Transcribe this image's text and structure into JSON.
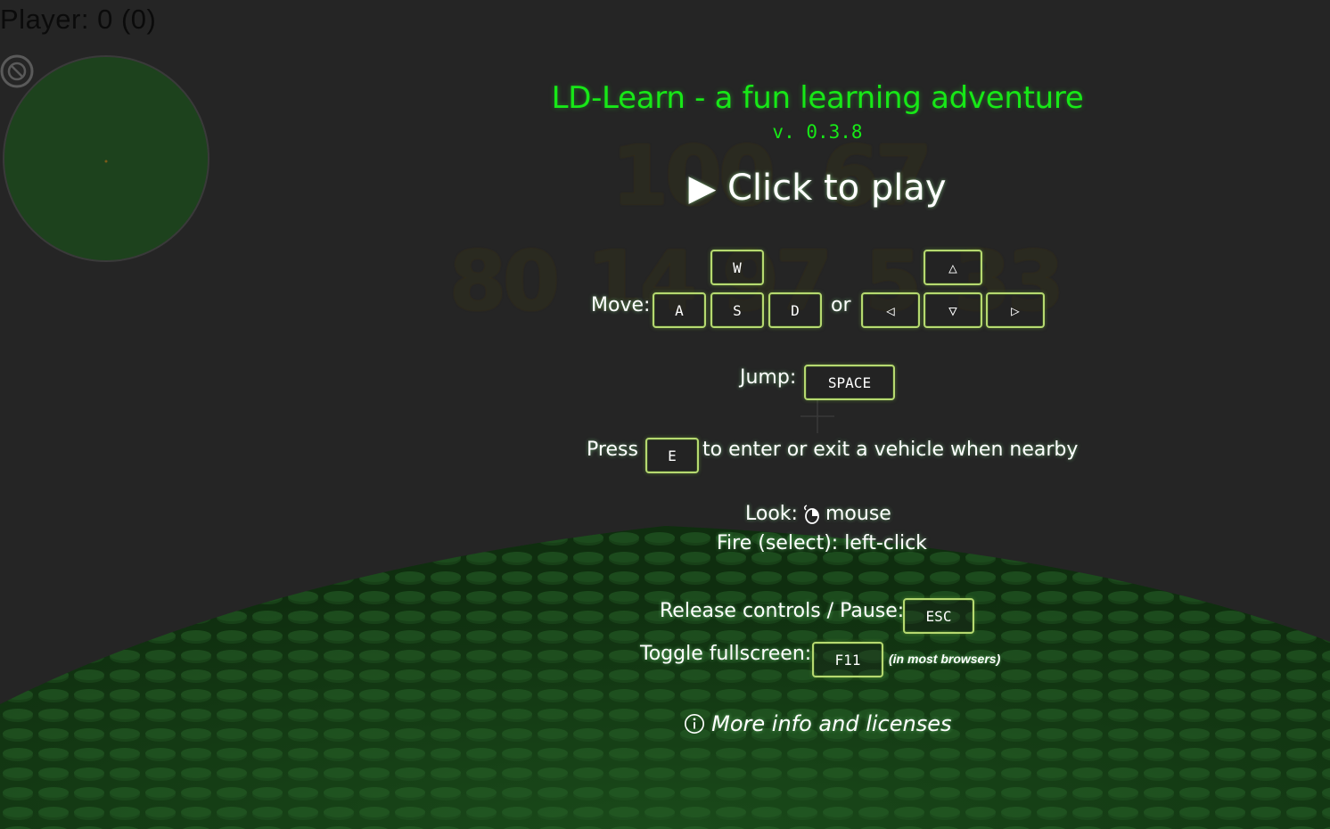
{
  "hud": {
    "score_text": "Player: 0 (0)"
  },
  "icons": {
    "blocked": "no-entry-icon",
    "radar": "radar-minimap",
    "crosshair": "crosshair-icon",
    "mouse": "mouse-icon",
    "info": "info-icon",
    "play": "play-icon"
  },
  "background_numbers": [
    "100",
    "67",
    "80",
    "14",
    "97",
    "5",
    "33"
  ],
  "menu": {
    "title": "LD-Learn - a fun learning adventure",
    "version": "v. 0.3.8",
    "play_label": "▶ Click to play",
    "move_label": "Move:",
    "or_label": "or",
    "keys": {
      "w": "W",
      "a": "A",
      "s": "S",
      "d": "D",
      "up": "△",
      "left": "◁",
      "down": "▽",
      "right": "▷",
      "space": "SPACE",
      "e": "E",
      "esc": "ESC",
      "f11": "F11"
    },
    "jump_label": "Jump:",
    "press_label": "Press",
    "vehicle_text": "to enter or exit a vehicle when nearby",
    "look_label": "Look:",
    "look_value": "mouse",
    "fire_text": "Fire (select): left-click",
    "release_label": "Release controls / Pause:",
    "fullscreen_label": "Toggle fullscreen:",
    "fullscreen_note": "(in most browsers)",
    "more_info": "More info and licenses"
  },
  "colors": {
    "background": "#252525",
    "ground": "#163a16",
    "title_green": "#17e817",
    "key_border": "#b6d970",
    "radar_fill": "#1d421d"
  }
}
